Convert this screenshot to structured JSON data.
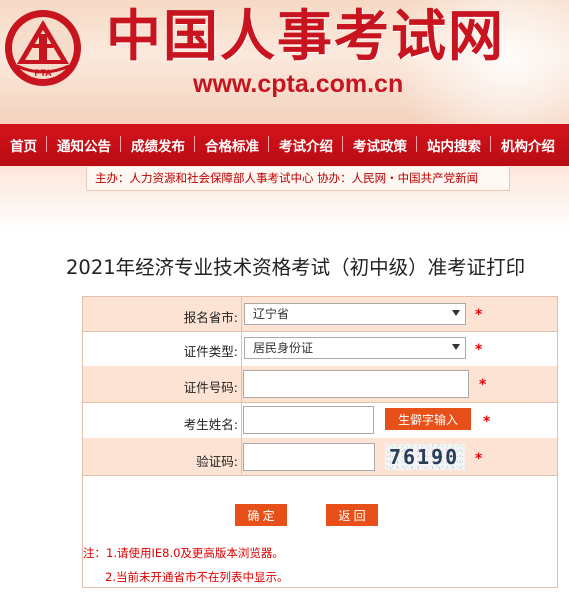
{
  "header": {
    "logo_text": "PTA",
    "site_title": "中国人事考试网",
    "site_url": "www.cpta.com.cn"
  },
  "nav": {
    "items": [
      "首页",
      "通知公告",
      "成绩发布",
      "合格标准",
      "考试介绍",
      "考试政策",
      "站内搜索",
      "机构介绍"
    ]
  },
  "sponsor": {
    "text": "主办：人力资源和社会保障部人事考试中心    协办：人民网・中国共产党新闻"
  },
  "page": {
    "title": "2021年经济专业技术资格考试（初中级）准考证打印"
  },
  "form": {
    "province_label": "报名省市:",
    "province_value": "辽宁省",
    "id_type_label": "证件类型:",
    "id_type_value": "居民身份证",
    "id_number_label": "证件号码:",
    "id_number_value": "",
    "name_label": "考生姓名:",
    "name_value": "",
    "rare_char_button": "生僻字输入",
    "captcha_label": "验证码:",
    "captcha_value": "",
    "captcha_image_text": "76190",
    "required_mark": "*",
    "confirm_button": "确  定",
    "back_button": "返  回",
    "note_1": "注：1.请使用IE8.0及更高版本浏览器。",
    "note_2": "2.当前未开通省市不在列表中显示。"
  },
  "colors": {
    "brand_red": "#c8141e",
    "nav_red": "#d4121b",
    "button_orange": "#e8501a",
    "row_alt_bg": "#fce3d3"
  }
}
